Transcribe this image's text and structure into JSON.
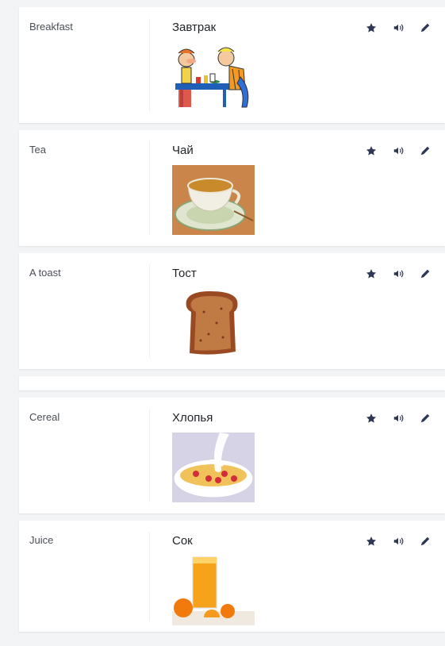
{
  "cards": [
    {
      "term": "Breakfast",
      "definition": "Завтрак",
      "image": "breakfast-cartoon"
    },
    {
      "term": "Tea",
      "definition": "Чай",
      "image": "tea-cup"
    },
    {
      "term": "A toast",
      "definition": "Тост",
      "image": "toast-slice"
    },
    {
      "term": "Cereal",
      "definition": "Хлопья",
      "image": "cereal-bowl"
    },
    {
      "term": "Juice",
      "definition": "Сок",
      "image": "orange-juice"
    }
  ],
  "icons": {
    "star": "star-icon",
    "audio": "speaker-icon",
    "edit": "pencil-icon"
  },
  "colors": {
    "background": "#f3f4f6",
    "card": "#ffffff",
    "icon": "#2e3856"
  }
}
